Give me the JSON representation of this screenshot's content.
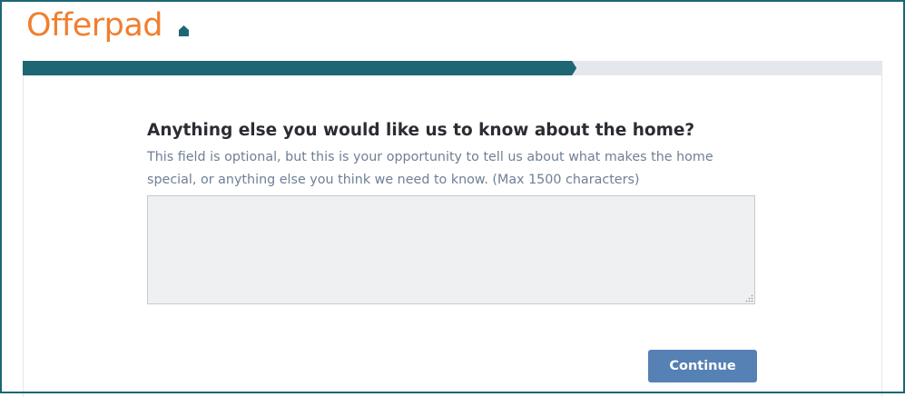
{
  "brand": {
    "name": "Offerpad",
    "logo_color": "#f07f2e",
    "mark_color": "#1e6674",
    "mark_icon": "house-icon"
  },
  "progress": {
    "fraction": 0.645,
    "fill_color": "#1e6674",
    "track_color": "#e4e7ec"
  },
  "form": {
    "question": "Anything else you would like us to know about the home?",
    "helper": "This field is optional, but this is your opportunity to tell us about what makes the home special, or anything else you think we need to know. (Max 1500 characters)",
    "textarea_value": "",
    "continue_label": "Continue",
    "button_color": "#5681b4"
  }
}
